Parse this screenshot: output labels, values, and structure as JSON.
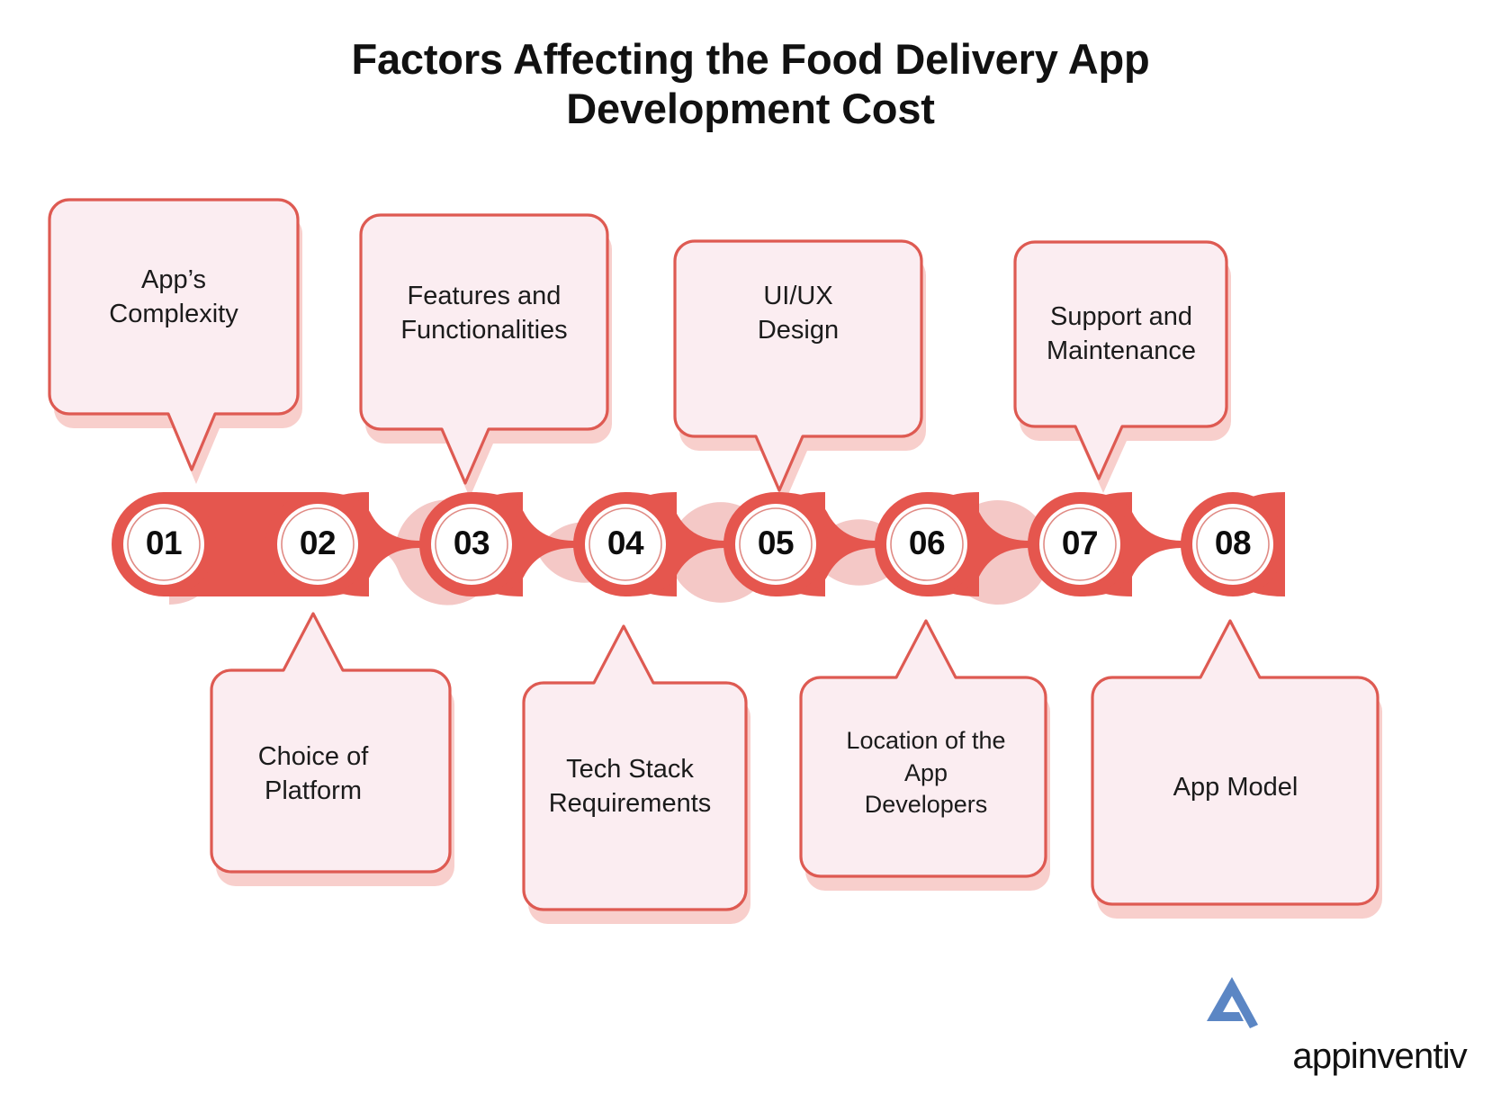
{
  "title": {
    "line1": "Factors Affecting the Food Delivery App",
    "line2": "Development Cost"
  },
  "colors": {
    "chain_red": "#E5564E",
    "box_border": "#DE5A52",
    "box_fill": "#FBEDF1",
    "shadow_pink": "#F7C9C6",
    "title_text": "#111111",
    "logo_blue": "#5B86C4"
  },
  "steps": [
    {
      "number": "01",
      "label_line1": "App’s",
      "label_line2": "Complexity",
      "position": "top"
    },
    {
      "number": "02",
      "label_line1": "Choice of",
      "label_line2": "Platform",
      "position": "bottom"
    },
    {
      "number": "03",
      "label_line1": "Features and",
      "label_line2": "Functionalities",
      "position": "top"
    },
    {
      "number": "04",
      "label_line1": "Tech Stack",
      "label_line2": "Requirements",
      "position": "bottom"
    },
    {
      "number": "05",
      "label_line1": "UI/UX",
      "label_line2": "Design",
      "position": "top"
    },
    {
      "number": "06",
      "label_line1": "Location of the",
      "label_line2": "App",
      "label_line3": "Developers",
      "position": "bottom"
    },
    {
      "number": "07",
      "label_line1": "Support and",
      "label_line2": "Maintenance",
      "position": "top"
    },
    {
      "number": "08",
      "label_line1": "App Model",
      "label_line2": "",
      "position": "bottom"
    }
  ],
  "logo": {
    "name": "appinventiv",
    "mark": "appinventiv-logo-mark"
  },
  "chart_data": {
    "type": "diagram",
    "title": "Factors Affecting the Food Delivery App Development Cost",
    "categories": [
      "01",
      "02",
      "03",
      "04",
      "05",
      "06",
      "07",
      "08"
    ],
    "labels": [
      "App’s Complexity",
      "Choice of Platform",
      "Features and Functionalities",
      "Tech Stack Requirements",
      "UI/UX Design",
      "Location of the App Developers",
      "Support and Maintenance",
      "App Model"
    ]
  }
}
